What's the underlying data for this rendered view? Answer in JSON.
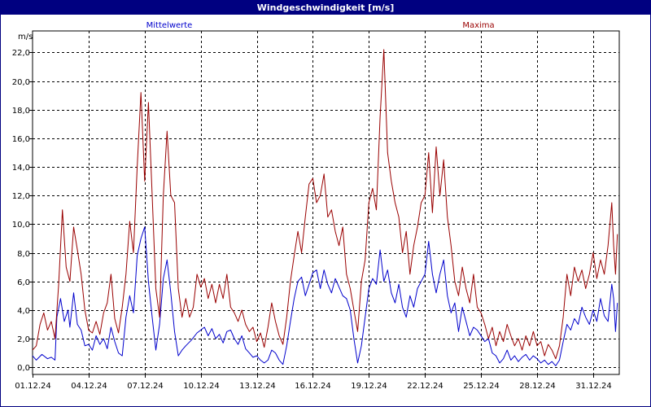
{
  "window": {
    "title": "Windgeschwindigkeit [m/s]"
  },
  "colors": {
    "titlebar": "#000080",
    "mean": "#0000cc",
    "max": "#990000",
    "grid": "#000000"
  },
  "chart_data": {
    "type": "line",
    "title": "Windgeschwindigkeit [m/s]",
    "ylabel": "m/s",
    "ylim": [
      -0.5,
      23.5
    ],
    "yticks": [
      "0,0",
      "2,0",
      "4,0",
      "6,0",
      "8,0",
      "10,0",
      "12,0",
      "14,0",
      "16,0",
      "18,0",
      "20,0",
      "22,0"
    ],
    "xticks": [
      "01.12.24",
      "04.12.24",
      "07.12.24",
      "10.12.24",
      "13.12.24",
      "16.12.24",
      "19.12.24",
      "22.12.24",
      "25.12.24",
      "28.12.24",
      "31.12.24"
    ],
    "xlim_days": [
      1,
      32.4
    ],
    "grid": true,
    "series": [
      {
        "name": "Mittelwerte",
        "color": "#0000cc",
        "points": [
          [
            1.0,
            0.8
          ],
          [
            1.2,
            0.5
          ],
          [
            1.5,
            0.9
          ],
          [
            1.8,
            0.6
          ],
          [
            2.0,
            0.7
          ],
          [
            2.2,
            0.5
          ],
          [
            2.3,
            3.5
          ],
          [
            2.5,
            4.8
          ],
          [
            2.7,
            3.2
          ],
          [
            2.9,
            4.0
          ],
          [
            3.0,
            2.8
          ],
          [
            3.2,
            5.2
          ],
          [
            3.4,
            3.0
          ],
          [
            3.6,
            2.6
          ],
          [
            3.8,
            1.5
          ],
          [
            4.0,
            1.6
          ],
          [
            4.2,
            1.2
          ],
          [
            4.4,
            2.2
          ],
          [
            4.6,
            1.6
          ],
          [
            4.8,
            2.0
          ],
          [
            5.0,
            1.3
          ],
          [
            5.2,
            2.8
          ],
          [
            5.4,
            1.8
          ],
          [
            5.6,
            1.0
          ],
          [
            5.8,
            0.8
          ],
          [
            6.0,
            3.5
          ],
          [
            6.2,
            5.0
          ],
          [
            6.4,
            3.8
          ],
          [
            6.6,
            7.8
          ],
          [
            6.8,
            9.0
          ],
          [
            7.0,
            9.8
          ],
          [
            7.2,
            6.0
          ],
          [
            7.4,
            3.5
          ],
          [
            7.6,
            1.2
          ],
          [
            7.8,
            3.0
          ],
          [
            8.0,
            6.2
          ],
          [
            8.2,
            7.5
          ],
          [
            8.4,
            5.2
          ],
          [
            8.6,
            2.5
          ],
          [
            8.8,
            0.8
          ],
          [
            9.0,
            1.2
          ],
          [
            9.2,
            1.5
          ],
          [
            9.5,
            1.9
          ],
          [
            9.8,
            2.4
          ],
          [
            10.0,
            2.6
          ],
          [
            10.2,
            2.8
          ],
          [
            10.4,
            2.2
          ],
          [
            10.6,
            2.7
          ],
          [
            10.8,
            2.0
          ],
          [
            11.0,
            2.3
          ],
          [
            11.2,
            1.7
          ],
          [
            11.4,
            2.5
          ],
          [
            11.6,
            2.6
          ],
          [
            11.8,
            2.0
          ],
          [
            12.0,
            1.6
          ],
          [
            12.2,
            2.2
          ],
          [
            12.4,
            1.3
          ],
          [
            12.6,
            1.0
          ],
          [
            12.8,
            0.7
          ],
          [
            13.0,
            0.8
          ],
          [
            13.2,
            0.5
          ],
          [
            13.4,
            0.3
          ],
          [
            13.6,
            0.5
          ],
          [
            13.8,
            1.2
          ],
          [
            14.0,
            1.0
          ],
          [
            14.2,
            0.5
          ],
          [
            14.4,
            0.2
          ],
          [
            14.6,
            1.5
          ],
          [
            14.8,
            3.2
          ],
          [
            15.0,
            4.8
          ],
          [
            15.2,
            6.0
          ],
          [
            15.4,
            6.3
          ],
          [
            15.6,
            5.0
          ],
          [
            15.8,
            5.8
          ],
          [
            16.0,
            6.6
          ],
          [
            16.2,
            6.8
          ],
          [
            16.4,
            5.5
          ],
          [
            16.6,
            6.8
          ],
          [
            16.8,
            5.8
          ],
          [
            17.0,
            5.2
          ],
          [
            17.2,
            6.2
          ],
          [
            17.4,
            5.6
          ],
          [
            17.6,
            5.0
          ],
          [
            17.8,
            4.8
          ],
          [
            18.0,
            4.0
          ],
          [
            18.2,
            2.0
          ],
          [
            18.4,
            0.3
          ],
          [
            18.6,
            1.5
          ],
          [
            18.8,
            3.5
          ],
          [
            19.0,
            5.5
          ],
          [
            19.2,
            6.2
          ],
          [
            19.4,
            5.8
          ],
          [
            19.6,
            8.2
          ],
          [
            19.8,
            6.0
          ],
          [
            20.0,
            6.8
          ],
          [
            20.2,
            5.2
          ],
          [
            20.4,
            4.5
          ],
          [
            20.6,
            5.8
          ],
          [
            20.8,
            4.2
          ],
          [
            21.0,
            3.5
          ],
          [
            21.2,
            5.0
          ],
          [
            21.4,
            4.2
          ],
          [
            21.6,
            5.5
          ],
          [
            21.8,
            6.0
          ],
          [
            22.0,
            6.5
          ],
          [
            22.2,
            8.8
          ],
          [
            22.4,
            6.5
          ],
          [
            22.6,
            5.2
          ],
          [
            22.8,
            6.5
          ],
          [
            23.0,
            7.5
          ],
          [
            23.2,
            5.0
          ],
          [
            23.4,
            3.8
          ],
          [
            23.6,
            4.5
          ],
          [
            23.8,
            2.5
          ],
          [
            24.0,
            4.2
          ],
          [
            24.2,
            3.2
          ],
          [
            24.4,
            2.2
          ],
          [
            24.6,
            2.8
          ],
          [
            24.8,
            2.6
          ],
          [
            25.0,
            2.2
          ],
          [
            25.2,
            1.8
          ],
          [
            25.4,
            2.0
          ],
          [
            25.6,
            1.0
          ],
          [
            25.8,
            0.8
          ],
          [
            26.0,
            0.3
          ],
          [
            26.2,
            0.6
          ],
          [
            26.4,
            1.2
          ],
          [
            26.6,
            0.5
          ],
          [
            26.8,
            0.8
          ],
          [
            27.0,
            0.4
          ],
          [
            27.2,
            0.7
          ],
          [
            27.4,
            0.9
          ],
          [
            27.6,
            0.5
          ],
          [
            27.8,
            0.8
          ],
          [
            28.0,
            0.6
          ],
          [
            28.2,
            0.3
          ],
          [
            28.4,
            0.5
          ],
          [
            28.6,
            0.2
          ],
          [
            28.8,
            0.4
          ],
          [
            29.0,
            0.1
          ],
          [
            29.2,
            0.5
          ],
          [
            29.4,
            1.8
          ],
          [
            29.6,
            3.0
          ],
          [
            29.8,
            2.6
          ],
          [
            30.0,
            3.4
          ],
          [
            30.2,
            3.0
          ],
          [
            30.4,
            4.2
          ],
          [
            30.6,
            3.5
          ],
          [
            30.8,
            3.0
          ],
          [
            31.0,
            4.0
          ],
          [
            31.2,
            3.2
          ],
          [
            31.4,
            4.8
          ],
          [
            31.6,
            3.6
          ],
          [
            31.8,
            3.2
          ],
          [
            32.0,
            5.8
          ],
          [
            32.1,
            4.8
          ],
          [
            32.2,
            2.5
          ],
          [
            32.3,
            4.5
          ]
        ]
      },
      {
        "name": "Maxima",
        "color": "#990000",
        "points": [
          [
            1.0,
            1.2
          ],
          [
            1.2,
            1.5
          ],
          [
            1.4,
            3.0
          ],
          [
            1.6,
            3.8
          ],
          [
            1.8,
            2.6
          ],
          [
            2.0,
            3.2
          ],
          [
            2.2,
            2.0
          ],
          [
            2.4,
            5.8
          ],
          [
            2.6,
            11.0
          ],
          [
            2.8,
            7.0
          ],
          [
            3.0,
            6.0
          ],
          [
            3.2,
            9.8
          ],
          [
            3.4,
            8.2
          ],
          [
            3.6,
            6.5
          ],
          [
            3.8,
            4.0
          ],
          [
            4.0,
            2.6
          ],
          [
            4.2,
            2.4
          ],
          [
            4.4,
            3.2
          ],
          [
            4.6,
            2.3
          ],
          [
            4.8,
            3.8
          ],
          [
            5.0,
            4.5
          ],
          [
            5.2,
            6.5
          ],
          [
            5.4,
            3.4
          ],
          [
            5.6,
            2.4
          ],
          [
            5.8,
            4.2
          ],
          [
            6.0,
            6.5
          ],
          [
            6.2,
            10.2
          ],
          [
            6.4,
            8.0
          ],
          [
            6.6,
            14.0
          ],
          [
            6.8,
            19.2
          ],
          [
            7.0,
            13.0
          ],
          [
            7.2,
            18.5
          ],
          [
            7.4,
            12.0
          ],
          [
            7.6,
            5.5
          ],
          [
            7.8,
            3.5
          ],
          [
            8.0,
            12.0
          ],
          [
            8.2,
            16.5
          ],
          [
            8.4,
            12.0
          ],
          [
            8.6,
            11.5
          ],
          [
            8.8,
            5.5
          ],
          [
            9.0,
            3.5
          ],
          [
            9.2,
            4.8
          ],
          [
            9.4,
            3.5
          ],
          [
            9.6,
            4.2
          ],
          [
            9.8,
            6.5
          ],
          [
            10.0,
            5.6
          ],
          [
            10.2,
            6.2
          ],
          [
            10.4,
            4.8
          ],
          [
            10.6,
            5.8
          ],
          [
            10.8,
            4.5
          ],
          [
            11.0,
            5.8
          ],
          [
            11.2,
            4.8
          ],
          [
            11.4,
            6.5
          ],
          [
            11.6,
            4.2
          ],
          [
            11.8,
            3.8
          ],
          [
            12.0,
            3.2
          ],
          [
            12.2,
            4.0
          ],
          [
            12.4,
            3.0
          ],
          [
            12.6,
            2.5
          ],
          [
            12.8,
            2.8
          ],
          [
            13.0,
            1.8
          ],
          [
            13.2,
            2.4
          ],
          [
            13.4,
            1.4
          ],
          [
            13.6,
            2.8
          ],
          [
            13.8,
            4.5
          ],
          [
            14.0,
            3.2
          ],
          [
            14.2,
            2.2
          ],
          [
            14.4,
            1.6
          ],
          [
            14.6,
            3.5
          ],
          [
            14.8,
            6.0
          ],
          [
            15.0,
            7.8
          ],
          [
            15.2,
            9.5
          ],
          [
            15.4,
            8.0
          ],
          [
            15.6,
            10.5
          ],
          [
            15.8,
            12.8
          ],
          [
            16.0,
            13.2
          ],
          [
            16.2,
            11.5
          ],
          [
            16.4,
            12.0
          ],
          [
            16.6,
            13.5
          ],
          [
            16.8,
            10.5
          ],
          [
            17.0,
            11.0
          ],
          [
            17.2,
            9.5
          ],
          [
            17.4,
            8.5
          ],
          [
            17.6,
            9.8
          ],
          [
            17.8,
            6.5
          ],
          [
            18.0,
            5.5
          ],
          [
            18.2,
            4.0
          ],
          [
            18.4,
            2.5
          ],
          [
            18.6,
            6.0
          ],
          [
            18.8,
            7.5
          ],
          [
            19.0,
            11.5
          ],
          [
            19.2,
            12.5
          ],
          [
            19.4,
            11.0
          ],
          [
            19.6,
            17.5
          ],
          [
            19.8,
            22.2
          ],
          [
            20.0,
            15.0
          ],
          [
            20.2,
            13.0
          ],
          [
            20.4,
            11.5
          ],
          [
            20.6,
            10.5
          ],
          [
            20.8,
            8.0
          ],
          [
            21.0,
            9.5
          ],
          [
            21.2,
            6.5
          ],
          [
            21.4,
            8.5
          ],
          [
            21.6,
            9.8
          ],
          [
            21.8,
            11.5
          ],
          [
            22.0,
            12.0
          ],
          [
            22.2,
            15.0
          ],
          [
            22.4,
            10.8
          ],
          [
            22.6,
            15.4
          ],
          [
            22.8,
            12.0
          ],
          [
            23.0,
            14.5
          ],
          [
            23.2,
            10.5
          ],
          [
            23.4,
            8.5
          ],
          [
            23.6,
            6.0
          ],
          [
            23.8,
            5.0
          ],
          [
            24.0,
            7.0
          ],
          [
            24.2,
            5.5
          ],
          [
            24.4,
            4.5
          ],
          [
            24.6,
            6.5
          ],
          [
            24.8,
            4.2
          ],
          [
            25.0,
            3.8
          ],
          [
            25.2,
            3.0
          ],
          [
            25.4,
            2.0
          ],
          [
            25.6,
            2.8
          ],
          [
            25.8,
            1.5
          ],
          [
            26.0,
            2.5
          ],
          [
            26.2,
            1.8
          ],
          [
            26.4,
            3.0
          ],
          [
            26.6,
            2.2
          ],
          [
            26.8,
            1.5
          ],
          [
            27.0,
            2.0
          ],
          [
            27.2,
            1.2
          ],
          [
            27.4,
            2.2
          ],
          [
            27.6,
            1.5
          ],
          [
            27.8,
            2.5
          ],
          [
            28.0,
            1.5
          ],
          [
            28.2,
            1.8
          ],
          [
            28.4,
            0.8
          ],
          [
            28.6,
            1.6
          ],
          [
            28.8,
            1.2
          ],
          [
            29.0,
            0.6
          ],
          [
            29.2,
            1.5
          ],
          [
            29.4,
            3.5
          ],
          [
            29.6,
            6.5
          ],
          [
            29.8,
            5.0
          ],
          [
            30.0,
            7.0
          ],
          [
            30.2,
            6.0
          ],
          [
            30.4,
            6.8
          ],
          [
            30.6,
            5.5
          ],
          [
            30.8,
            6.5
          ],
          [
            31.0,
            8.0
          ],
          [
            31.2,
            6.2
          ],
          [
            31.4,
            7.5
          ],
          [
            31.6,
            6.5
          ],
          [
            31.8,
            8.5
          ],
          [
            32.0,
            11.5
          ],
          [
            32.1,
            8.5
          ],
          [
            32.2,
            6.5
          ],
          [
            32.3,
            9.3
          ]
        ]
      }
    ]
  }
}
